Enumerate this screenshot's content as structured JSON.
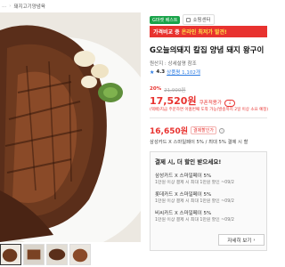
{
  "breadcrumb": {
    "prev": "...",
    "current": "돼지고기양념육"
  },
  "badges": {
    "best": "G마켓 베스트",
    "store": "쇼핑센터"
  },
  "promo": {
    "text": "가격비교 중 ",
    "accent": "온라인 최저가 발견!"
  },
  "product": {
    "title": "G오늘의돼지 칼집 양념 돼지 왕구이",
    "origin": "원산지 : 상세설명 참조",
    "rating": "4.3",
    "reviews": "상품평 1,102개"
  },
  "pricing": {
    "discount": "20%",
    "original": "21,900원",
    "current": "17,520원",
    "coupon_label": "쿠폰적용가",
    "coupon_chip": "↓",
    "delivery_note": "(택배)지금 주문하면 아홉번째 도착 가능(발송까지 2일 이상 소요 예정)"
  },
  "card_offer": {
    "price": "16,650원",
    "label": "결제할인가",
    "info": "i",
    "line": "삼성카드 X 스마일페이 5% / 최대 5% 결제 시 할"
  },
  "benefits": {
    "title": "결제 시, 더 할인 받으세요!",
    "items": [
      {
        "name": "삼성카드 X 스마일페이 5%",
        "desc": "1만원 이상 결제 시 최대 1만원 할인 ~09/2"
      },
      {
        "name": "롯데카드 X 스마일페이 5%",
        "desc": "1만원 이상 결제 시 최대 1만원 할인 ~09/2"
      },
      {
        "name": "비씨카드 X 스마일페이 5%",
        "desc": "1만원 이상 결제 시 최대 1만원 할인 ~09/2"
      }
    ],
    "more": "자세히 보기",
    "more_icon": "›"
  },
  "colors": {
    "accent": "#e8322f",
    "best": "#1aa34a",
    "link": "#2a7ae2"
  }
}
